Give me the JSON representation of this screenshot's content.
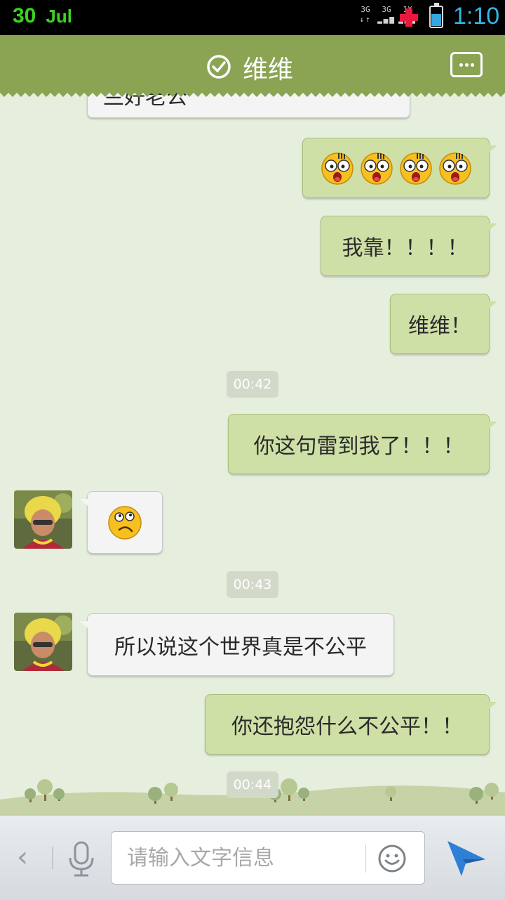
{
  "status_bar": {
    "day": "30",
    "month": "Jul",
    "network_labels": [
      "3G",
      "3G",
      "1X"
    ],
    "time": "1:10",
    "icons": [
      "network-signal-icon",
      "medical-cross-icon",
      "battery-icon"
    ],
    "colors": {
      "date": "#3cd321",
      "time": "#33b5e5",
      "cross": "#e8193c"
    }
  },
  "header": {
    "contact_name": "维维",
    "verified_icon": "check-circle-icon",
    "menu_icon": "more-options-icon",
    "background": "#8aa453"
  },
  "chat": {
    "partial_top_message": "兰好老公",
    "messages": [
      {
        "kind": "emoji",
        "direction": "out",
        "emoji": "shocked-face-icon",
        "count": 4
      },
      {
        "kind": "text",
        "direction": "out",
        "text": "我靠！！！！"
      },
      {
        "kind": "text",
        "direction": "out",
        "text": "维维！"
      },
      {
        "kind": "time",
        "text": "00:42"
      },
      {
        "kind": "text",
        "direction": "out",
        "text": "你这句雷到我了！！！"
      },
      {
        "kind": "emoji",
        "direction": "in",
        "emoji": "confused-face-icon",
        "count": 1
      },
      {
        "kind": "time",
        "text": "00:43"
      },
      {
        "kind": "text",
        "direction": "in",
        "text": "所以说这个世界真是不公平"
      },
      {
        "kind": "text",
        "direction": "out",
        "text": "你还抱怨什么不公平！！"
      },
      {
        "kind": "time",
        "text": "00:44"
      }
    ],
    "colors": {
      "incoming": "#f4f4f4",
      "outgoing": "#cfe0a7",
      "background": "#e6eedd"
    }
  },
  "input_bar": {
    "placeholder": "请输入文字信息",
    "icons": [
      "back-arrow-icon",
      "microphone-icon",
      "smiley-icon",
      "send-icon"
    ],
    "send_color": "#2f7fd6"
  }
}
